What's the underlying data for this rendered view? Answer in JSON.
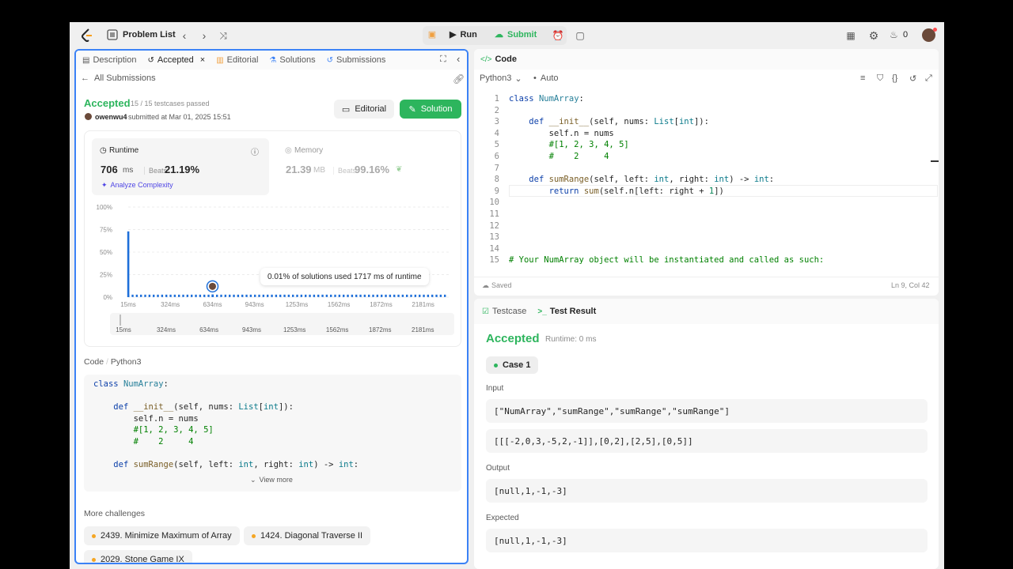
{
  "topbar": {
    "problem_list": "Problem List",
    "run": "Run",
    "submit": "Submit",
    "streak": "0"
  },
  "left_tabs": {
    "description": "Description",
    "accepted": "Accepted",
    "editorial": "Editorial",
    "solutions": "Solutions",
    "submissions": "Submissions"
  },
  "submission": {
    "back": "All Submissions",
    "status": "Accepted",
    "passed": "15 / 15 testcases passed",
    "user": "owenwu4",
    "submitted": "submitted at Mar 01, 2025 15:51",
    "editorial_btn": "Editorial",
    "solution_btn": "Solution"
  },
  "runtime": {
    "label": "Runtime",
    "value": "706",
    "unit": "ms",
    "beats_label": "Beats",
    "beats": "21.19%",
    "analyze": "Analyze Complexity"
  },
  "memory": {
    "label": "Memory",
    "value": "21.39",
    "unit": "MB",
    "beats_label": "Beats",
    "beats": "99.16%"
  },
  "chart_data": {
    "type": "bar",
    "y_ticks": [
      "100%",
      "75%",
      "50%",
      "25%",
      "0%"
    ],
    "x_ticks": [
      "15ms",
      "324ms",
      "634ms",
      "943ms",
      "1253ms",
      "1562ms",
      "1872ms",
      "2181ms"
    ],
    "ylim": [
      0,
      100
    ],
    "xlim": [
      15,
      2340
    ],
    "bars": [
      {
        "x": 15,
        "y": 73
      },
      {
        "x": 634,
        "y": 3
      }
    ],
    "baseline_y": 1,
    "tooltip": "0.01% of solutions used 1717 ms of runtime",
    "color": "#1e6fd9"
  },
  "code_section": {
    "label": "Code",
    "lang": "Python3",
    "view_more": "View more",
    "lines": [
      "class NumArray:",
      "",
      "    def __init__(self, nums: List[int]):",
      "        self.n = nums",
      "        #[1, 2, 3, 4, 5]",
      "        #    2     4",
      "",
      "    def sumRange(self, left: int, right: int) -> int:"
    ]
  },
  "more_challenges": {
    "title": "More challenges",
    "items": [
      "2439. Minimize Maximum of Array",
      "1424. Diagonal Traverse II",
      "2029. Stone Game IX"
    ]
  },
  "editor": {
    "title": "Code",
    "lang": "Python3",
    "auto": "Auto",
    "saved": "Saved",
    "position": "Ln 9, Col 42",
    "line_numbers": [
      "1",
      "2",
      "3",
      "4",
      "5",
      "6",
      "7",
      "8",
      "9",
      "10",
      "11",
      "12",
      "13",
      "14",
      "15"
    ],
    "lines": [
      "class NumArray:",
      "",
      "    def __init__(self, nums: List[int]):",
      "        self.n = nums",
      "        #[1, 2, 3, 4, 5]",
      "        #    2     4",
      "",
      "    def sumRange(self, left: int, right: int) -> int:",
      "        return sum(self.n[left: right + 1])",
      "",
      "",
      "",
      "",
      "",
      "# Your NumArray object will be instantiated and called as such:"
    ]
  },
  "result": {
    "testcase_tab": "Testcase",
    "result_tab": "Test Result",
    "status": "Accepted",
    "runtime": "Runtime: 0 ms",
    "case": "Case 1",
    "input_label": "Input",
    "input1": "[\"NumArray\",\"sumRange\",\"sumRange\",\"sumRange\"]",
    "input2": "[[[-2,0,3,-5,2,-1]],[0,2],[2,5],[0,5]]",
    "output_label": "Output",
    "output": "[null,1,-1,-3]",
    "expected_label": "Expected",
    "expected": "[null,1,-1,-3]"
  }
}
